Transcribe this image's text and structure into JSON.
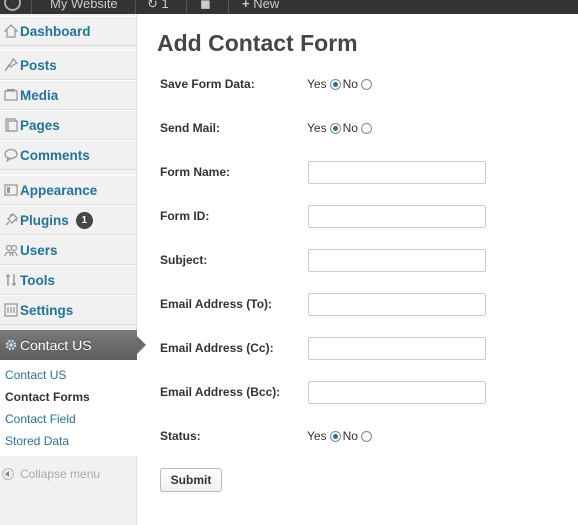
{
  "adminbar": {
    "site_name": "My Website",
    "updates_count": "1",
    "new_label": "New"
  },
  "sidebar": {
    "items": [
      {
        "label": "Dashboard",
        "icon": "dashboard-icon"
      },
      {
        "label": "Posts",
        "icon": "pin-icon"
      },
      {
        "label": "Media",
        "icon": "media-icon"
      },
      {
        "label": "Pages",
        "icon": "pages-icon"
      },
      {
        "label": "Comments",
        "icon": "comment-icon"
      },
      {
        "label": "Appearance",
        "icon": "appearance-icon"
      },
      {
        "label": "Plugins",
        "icon": "plugin-icon",
        "badge": "1"
      },
      {
        "label": "Users",
        "icon": "users-icon"
      },
      {
        "label": "Tools",
        "icon": "tools-icon"
      },
      {
        "label": "Settings",
        "icon": "settings-icon"
      }
    ],
    "active": {
      "label": "Contact US",
      "icon": "gear-icon"
    },
    "submenu": [
      "Contact US",
      "Contact Forms",
      "Contact Field",
      "Stored Data"
    ],
    "collapse_label": "Collapse menu"
  },
  "main": {
    "title": "Add Contact Form",
    "save_form_data": {
      "label": "Save Form Data:",
      "yes": "Yes",
      "no": "No",
      "selected": "Yes"
    },
    "send_mail": {
      "label": "Send Mail:",
      "yes": "Yes",
      "no": "No",
      "selected": "Yes"
    },
    "form_name": {
      "label": "Form Name:",
      "value": ""
    },
    "form_id": {
      "label": "Form ID:",
      "value": ""
    },
    "subject": {
      "label": "Subject:",
      "value": ""
    },
    "email_to": {
      "label": "Email Address (To):",
      "value": ""
    },
    "email_cc": {
      "label": "Email Address (Cc):",
      "value": ""
    },
    "email_bcc": {
      "label": "Email Address (Bcc):",
      "value": ""
    },
    "status": {
      "label": "Status:",
      "yes": "Yes",
      "no": "No",
      "selected": "Yes"
    },
    "submit_label": "Submit"
  },
  "colors": {
    "link": "#21759b",
    "adminbar": "#333333",
    "active_menu": "#6a6a6a"
  }
}
